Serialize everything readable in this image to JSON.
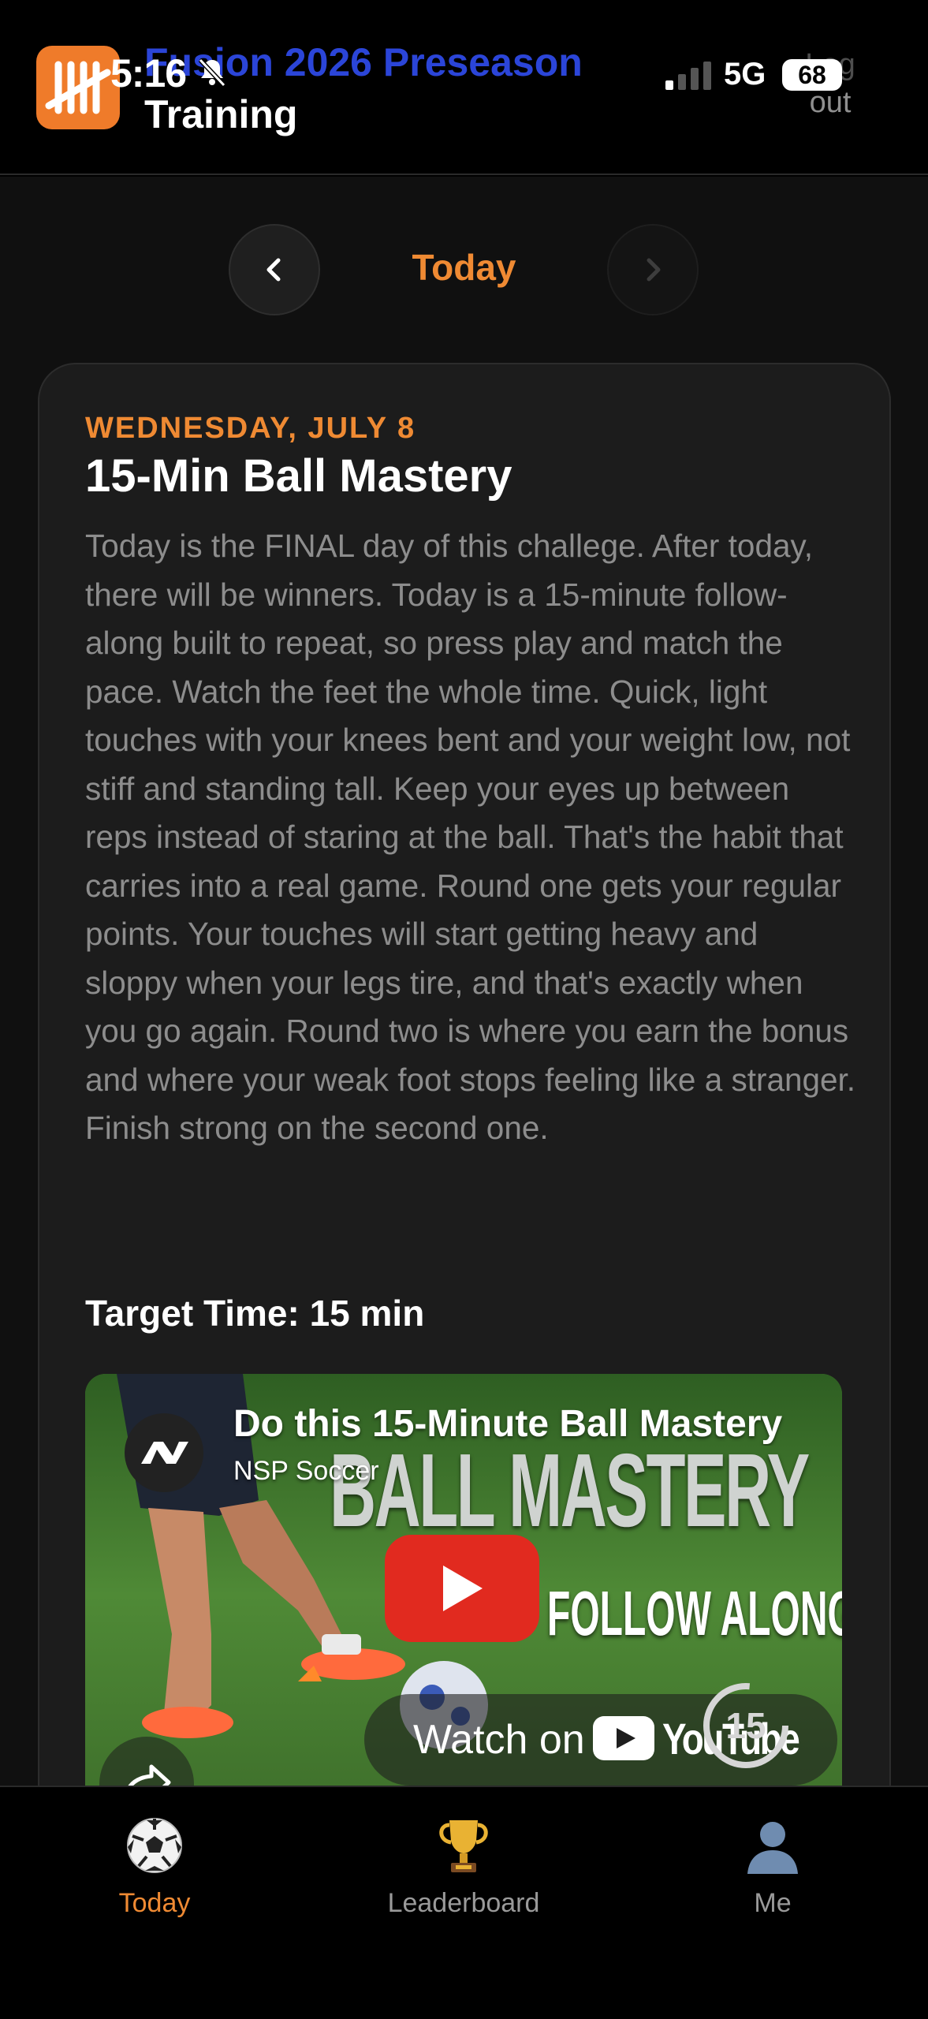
{
  "status_bar": {
    "time": "5:16",
    "network": "5G",
    "battery": "68"
  },
  "header": {
    "team_name_line1": "Fusion 2026 Preseason",
    "team_name_line2": "Training",
    "logout_line1": "Log",
    "logout_line2": "out"
  },
  "day_nav": {
    "label": "Today"
  },
  "card": {
    "date": "WEDNESDAY, JULY 8",
    "title": "15-Min Ball Mastery",
    "description": "Today is the FINAL day of this challege. After today, there will be winners. Today is a 15-minute follow-along built to repeat, so press play and match the pace. Watch the feet the whole time. Quick, light touches with your knees bent and your weight low, not stiff and standing tall. Keep your eyes up between reps instead of staring at the ball. That's the habit that carries into a real game. Round one gets your regular points. Your touches will start getting heavy and sloppy when your legs tire, and that's exactly when you go again. Round two is where you earn the bonus and where your weak foot stops feeling like a stranger. Finish strong on the second one.",
    "target_time": "Target Time: 15 min"
  },
  "video": {
    "title": "Do this 15-Minute Ball Mastery",
    "channel": "NSP Soccer",
    "thumbnail_text_1": "BALL MASTERY",
    "thumbnail_text_2": "FOLLOW ALONG",
    "watch_on": "Watch on",
    "youtube": "YouTube",
    "timer_badge": "15"
  },
  "tabbar": {
    "items": [
      {
        "label": "Today",
        "icon": "soccer-ball-icon",
        "active": true
      },
      {
        "label": "Leaderboard",
        "icon": "trophy-icon",
        "active": false
      },
      {
        "label": "Me",
        "icon": "person-icon",
        "active": false
      }
    ]
  },
  "colors": {
    "accent": "#ef8a33",
    "brand_logo": "#ef7b2a",
    "team_title": "#2b45d8",
    "card_bg": "#1c1c1c",
    "text_muted": "#8d8d8d",
    "youtube_red": "#e12a1f"
  }
}
